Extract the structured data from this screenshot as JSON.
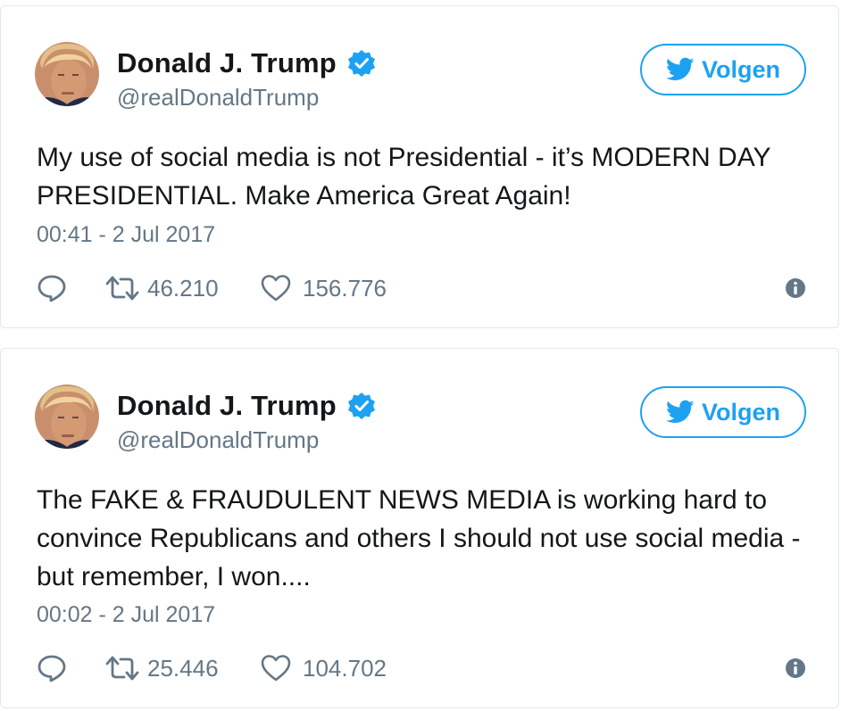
{
  "tweets": [
    {
      "name": "Donald J. Trump",
      "handle": "@realDonaldTrump",
      "follow_label": "Volgen",
      "text": "My use of social media is not Presidential - it’s MODERN DAY PRESIDENTIAL. Make America Great Again!",
      "timestamp": "00:41 - 2 Jul 2017",
      "retweets": "46.210",
      "likes": "156.776"
    },
    {
      "name": "Donald J. Trump",
      "handle": "@realDonaldTrump",
      "follow_label": "Volgen",
      "text": "The FAKE & FRAUDULENT NEWS MEDIA is working hard to convince Republicans and others I should not use social media - but remember, I won....",
      "timestamp": "00:02 - 2 Jul 2017",
      "retweets": "25.446",
      "likes": "104.702"
    }
  ],
  "icons": {
    "verified": "verified-badge-icon",
    "bird": "twitter-bird-icon",
    "reply": "reply-icon",
    "retweet": "retweet-icon",
    "like": "heart-icon",
    "info": "info-icon"
  },
  "colors": {
    "accent": "#1da1f2",
    "secondary_text": "#657786",
    "border": "#e1e8ed"
  }
}
